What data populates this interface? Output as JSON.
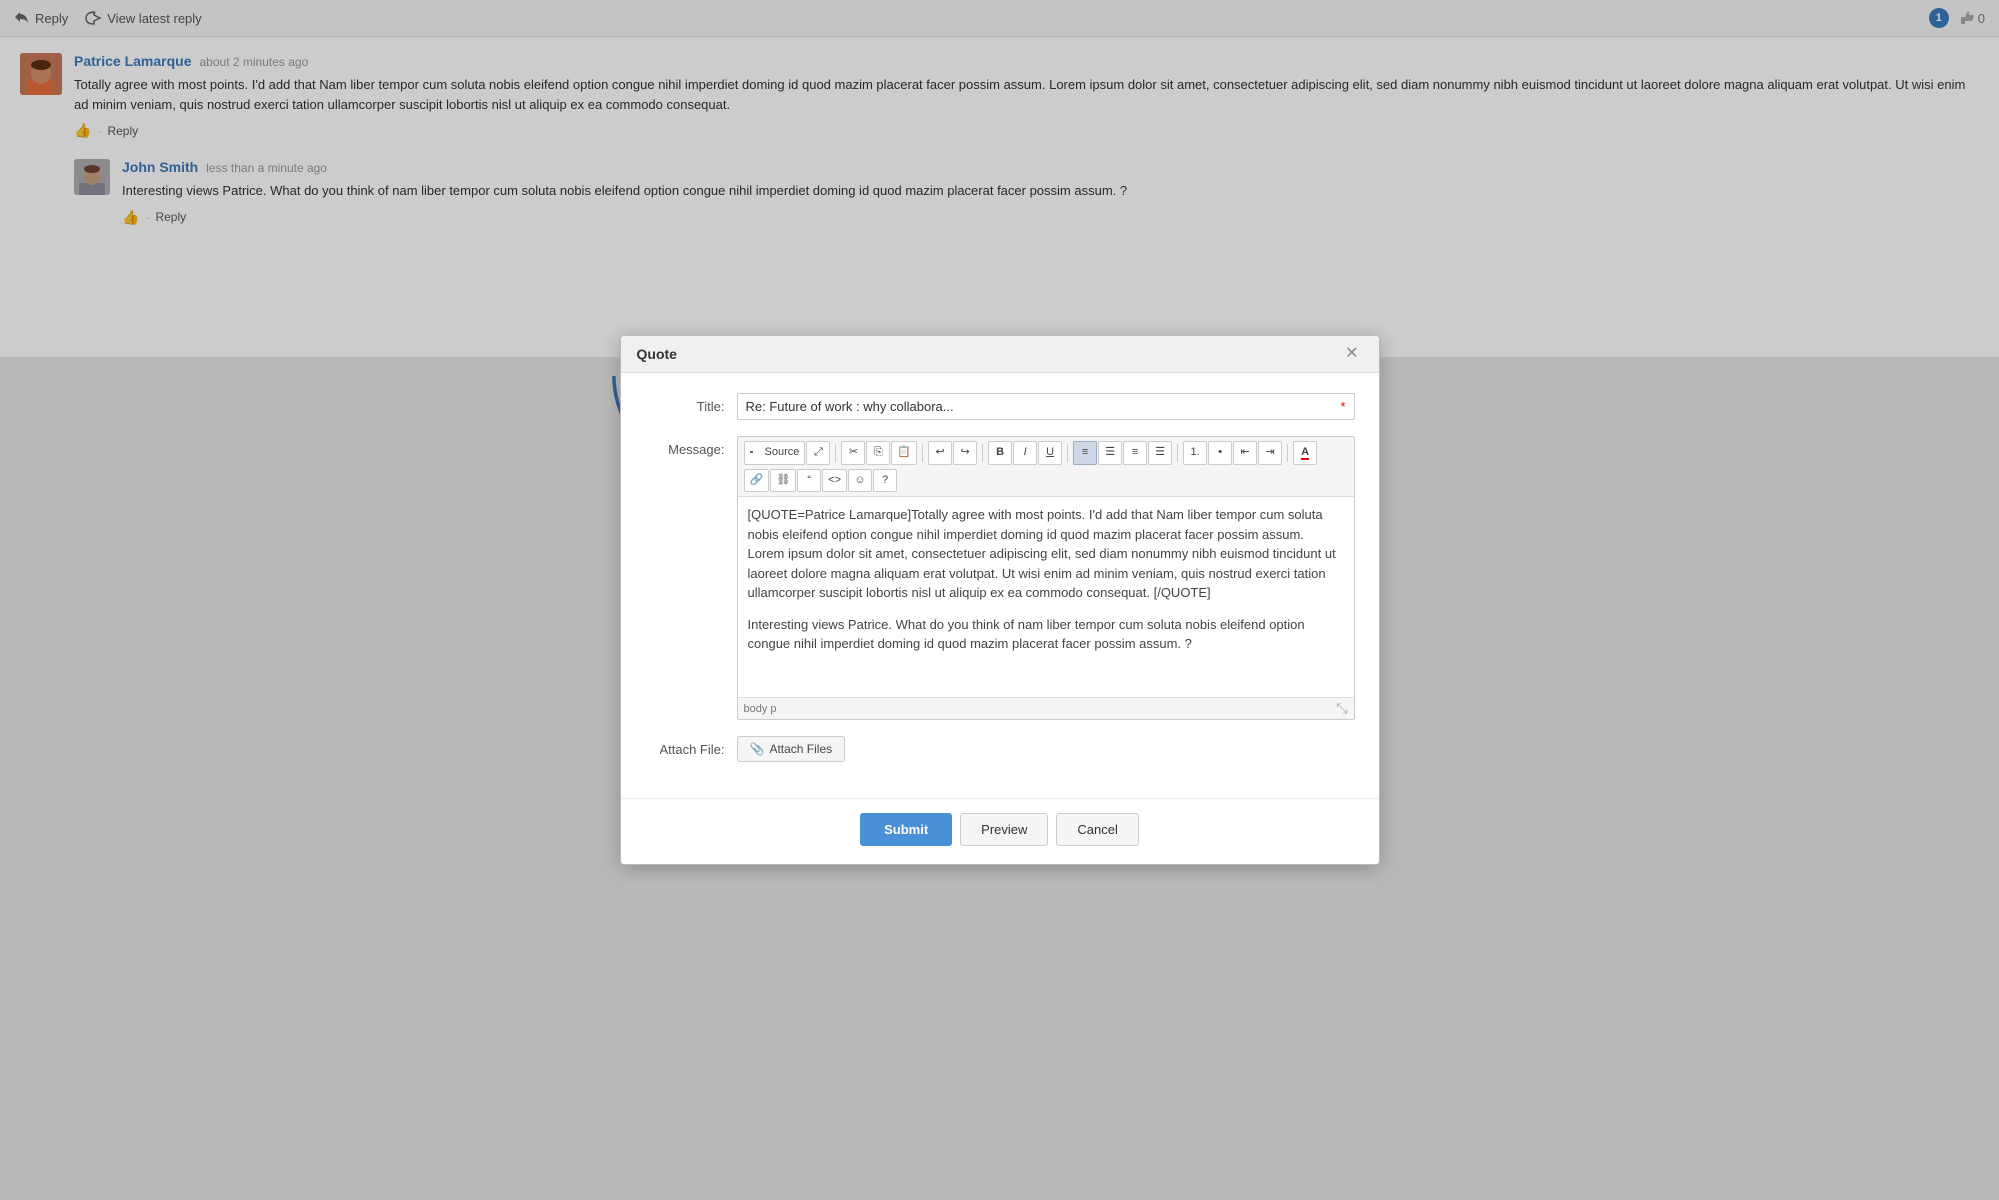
{
  "topbar": {
    "reply_label": "Reply",
    "view_latest_label": "View latest reply",
    "comment_count": "1",
    "like_count": "0"
  },
  "comments": [
    {
      "id": "patrice",
      "name": "Patrice Lamarque",
      "time": "about 2 minutes ago",
      "text": "Totally agree with most points. I'd add that Nam liber tempor cum soluta nobis eleifend option congue nihil imperdiet doming id quod mazim placerat facer possim assum. Lorem ipsum dolor sit amet, consectetuer adipiscing elit, sed diam nonummy nibh euismod tincidunt ut laoreet dolore magna aliquam erat volutpat. Ut wisi enim ad minim veniam, quis nostrud exerci tation ullamcorper suscipit lobortis nisl ut aliquip ex ea commodo consequat.",
      "reply_label": "Reply"
    },
    {
      "id": "john",
      "name": "John Smith",
      "time": "less than a minute ago",
      "text": "Interesting views Patrice. What do you think of nam liber tempor cum soluta nobis eleifend option congue nihil imperdiet doming id quod mazim placerat facer possim assum. ?",
      "reply_label": "Reply"
    }
  ],
  "modal": {
    "title": "Quote",
    "title_label": "Title:",
    "title_value": "Re: Future of work : why collabora...",
    "title_required": "*",
    "message_label": "Message:",
    "attach_label": "Attach File:",
    "toolbar": {
      "source_btn": "Source",
      "bold_btn": "B",
      "italic_btn": "I",
      "underline_btn": "U"
    },
    "editor_quote": "[QUOTE=Patrice Lamarque]Totally agree with most points. I'd add that Nam liber tempor cum soluta nobis eleifend option congue nihil imperdiet doming id quod mazim placerat facer possim assum. Lorem ipsum dolor sit amet, consectetuer adipiscing elit, sed diam nonummy nibh euismod tincidunt ut laoreet dolore magna aliquam erat volutpat. Ut wisi enim ad minim veniam, quis nostrud exerci tation ullamcorper suscipit lobortis nisl ut aliquip ex ea commodo consequat. [/QUOTE]",
    "editor_reply": "Interesting views Patrice. What do you think of nam liber tempor cum soluta nobis eleifend option congue nihil imperdiet doming id quod mazim placerat facer possim assum. ?",
    "statusbar": "body  p",
    "attach_files_btn": "Attach Files",
    "submit_btn": "Submit",
    "preview_btn": "Preview",
    "cancel_btn": "Cancel"
  }
}
